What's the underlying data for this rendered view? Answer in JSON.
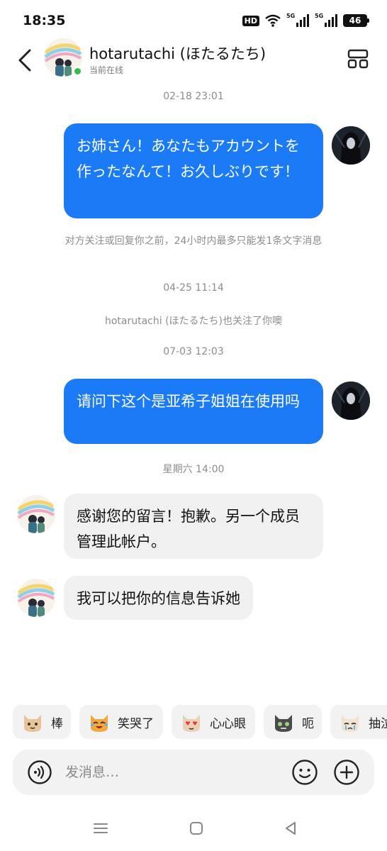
{
  "status_bar": {
    "time": "18:35",
    "hd_label": "HD",
    "network_1": "5G",
    "network_2": "5G",
    "battery": "46",
    "icons": [
      "hd-icon",
      "wifi-icon",
      "signal-icon",
      "signal-icon",
      "battery-icon"
    ]
  },
  "header": {
    "contact_name": "hotarutachi (ほたるたち)",
    "contact_status": "当前在线",
    "back_icon": "chevron-left-icon",
    "menu_icon": "layout-grid-icon"
  },
  "chat": {
    "timestamps": [
      "02-18 23:01",
      "04-25 11:14",
      "07-03 12:03",
      "星期六 14:00"
    ],
    "messages": [
      {
        "direction": "out",
        "text": "お姉さん！あなたもアカウントを作ったなんて！お久しぶりです！"
      },
      {
        "direction": "out",
        "text": "请问下这个是亚希子姐姐在使用吗"
      },
      {
        "direction": "in",
        "text": "感谢您的留言！抱歉。另一个成员管理此帐户。"
      },
      {
        "direction": "in",
        "text": "我可以把你的信息告诉她"
      }
    ],
    "system_notes": [
      "对方关注或回复你之前，24小时内最多只能发1条文字消息",
      "hotarutachi (ほたるたち)也关注了你噢"
    ]
  },
  "quick_replies": [
    {
      "label": "棒",
      "icon": "cat-thumbs-up-icon"
    },
    {
      "label": "笑哭了",
      "icon": "cat-laugh-cry-icon"
    },
    {
      "label": "心心眼",
      "icon": "cat-heart-eyes-icon"
    },
    {
      "label": "呃",
      "icon": "cat-awkward-icon"
    },
    {
      "label": "抽泣",
      "icon": "cat-sob-icon"
    }
  ],
  "input": {
    "placeholder": "发消息…",
    "value": "",
    "icons": [
      "voice-icon",
      "emoji-icon",
      "plus-icon"
    ]
  },
  "nav": {
    "icons": [
      "menu-icon",
      "home-square-icon",
      "back-triangle-icon"
    ]
  },
  "colors": {
    "accent": "#1b7bf6",
    "incoming_bubble": "#f0f0f0",
    "online": "#2fbf4a",
    "muted_text": "#8c8c8c"
  }
}
